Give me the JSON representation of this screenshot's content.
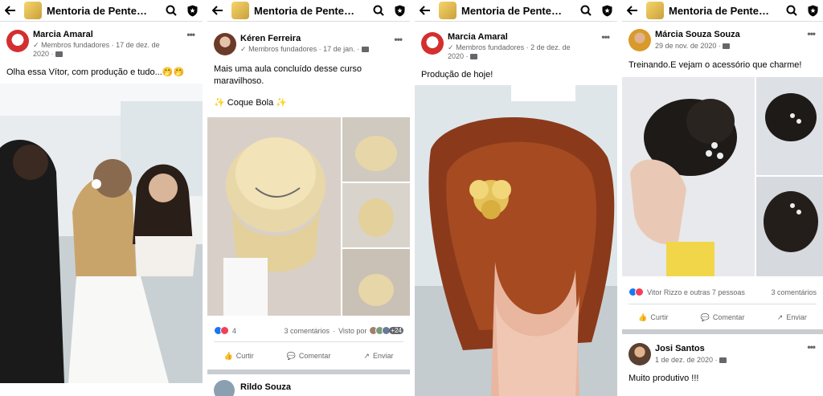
{
  "group_title": "Mentoria de Pente…",
  "panels": [
    {
      "author": "Marcia Amaral",
      "badge": "Membros fundadores",
      "date": "17 de dez. de 2020",
      "text": "Olha essa Vítor, com produção e tudo...🤭🤭",
      "photo_desc": "hairstylist-salon-photo"
    },
    {
      "author": "Kéren Ferreira",
      "badge": "Membros fundadores",
      "date": "17 de jan.",
      "text": "Mais uma aula concluído desse curso maravilhoso.",
      "text2": "✨ Coque Bola ✨",
      "reaction_count": "4",
      "comments": "3 comentários",
      "seen_by": "Visto por",
      "seen_count": "+24",
      "like": "Curtir",
      "comment": "Comentar",
      "share": "Enviar",
      "next_author": "Rildo Souza"
    },
    {
      "author": "Marcia Amaral",
      "badge": "Membros fundadores",
      "date": "2 de dez. de 2020",
      "text": "Produção de hoje!"
    },
    {
      "author": "Márcia Souza Souza",
      "date": "29 de nov. de 2020",
      "text": "Treinando.E vejam o acessório que charme!",
      "reactions": "Vitor Rizzo e outras 7 pessoas",
      "comments": "3 comentários",
      "like": "Curtir",
      "comment": "Comentar",
      "share": "Enviar",
      "next_author": "Josi Santos",
      "next_date": "1 de dez. de 2020",
      "next_text": "Muito produtivo !!!"
    }
  ],
  "colors": {
    "like_blue": "#1877f2",
    "love_red": "#f33e58",
    "meta_gray": "#65676b",
    "divider": "#c9ccd1"
  }
}
